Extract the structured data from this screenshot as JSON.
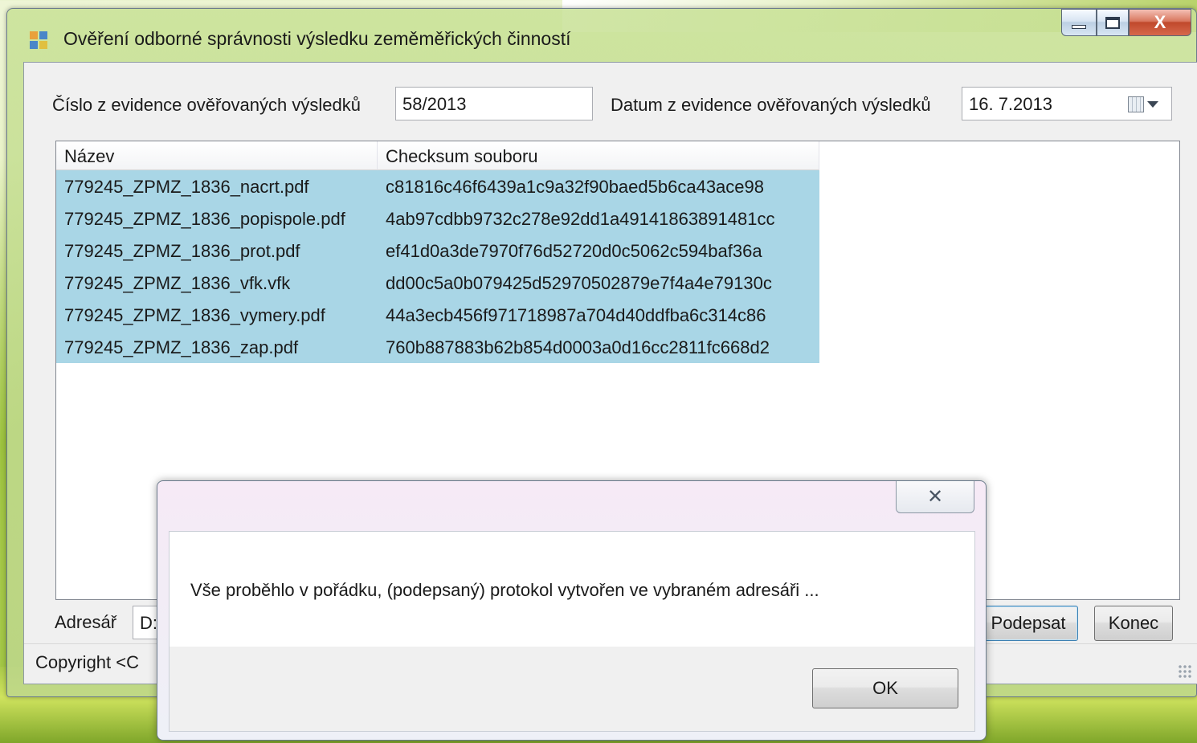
{
  "window": {
    "title": "Ověření odborné správnosti výsledku zeměměřických činností",
    "caption_buttons": {
      "minimize": "minimize-icon",
      "maximize": "maximize-icon",
      "close": "X"
    }
  },
  "form": {
    "number_label": "Číslo z evidence ověřovaných výsledků",
    "number_value": "58/2013",
    "date_label": "Datum z evidence ověřovaných výsledků",
    "date_value": "16.  7.2013",
    "date_button_icon": "calendar-dropdown-icon"
  },
  "file_list": {
    "columns": [
      "Název",
      "Checksum souboru"
    ],
    "rows": [
      [
        "779245_ZPMZ_1836_nacrt.pdf",
        "c81816c46f6439a1c9a32f90baed5b6ca43ace98"
      ],
      [
        "779245_ZPMZ_1836_popispole.pdf",
        "4ab97cdbb9732c278e92dd1a49141863891481cc"
      ],
      [
        "779245_ZPMZ_1836_prot.pdf",
        "ef41d0a3de7970f76d52720d0c5062c594baf36a"
      ],
      [
        "779245_ZPMZ_1836_vfk.vfk",
        "dd00c5a0b079425d52970502879e7f4a4e79130c"
      ],
      [
        "779245_ZPMZ_1836_vymery.pdf",
        "44a3ecb456f971718987a704d40ddfba6c314c86"
      ],
      [
        "779245_ZPMZ_1836_zap.pdf",
        "760b887883b62b854d0003a0d16cc2811fc668d2"
      ]
    ]
  },
  "bottom": {
    "dir_label": "Adresář",
    "dir_value": "D:",
    "sign_button": "Podepsat",
    "end_button": "Konec",
    "status_text": "Copyright <C"
  },
  "dialog": {
    "close_glyph": "✕",
    "message": "Vše proběhlo v pořádku, (podepsaný) protokol vytvořen ve vybraném adresáři ...",
    "ok_button": "OK"
  }
}
